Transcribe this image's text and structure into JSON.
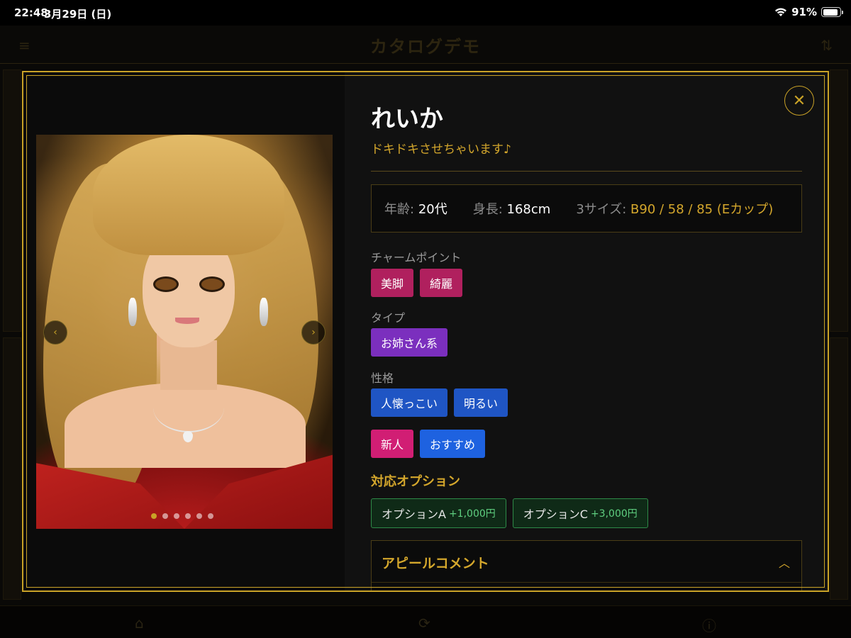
{
  "status_bar": {
    "time": "22:48",
    "date": "3月29日 (日)",
    "battery": "91%",
    "battery_level": 0.91,
    "wifi_icon": "wifi-icon"
  },
  "background": {
    "title": "カタログデモ",
    "menu_icon": "≡",
    "filter_icon": "⇅",
    "tabs": [
      "⌂",
      "⟳",
      "ⓘ"
    ]
  },
  "gallery": {
    "prev_icon": "‹",
    "next_icon": "›",
    "dot_count": 6,
    "active_dot": 0
  },
  "profile": {
    "close_icon": "✕",
    "name": "れいか",
    "catchphrase": "ドキドキさせちゃいます♪",
    "stats": {
      "age_label": "年齢:",
      "age": "20代",
      "height_label": "身長:",
      "height": "168cm",
      "size_label": "3サイズ:",
      "size": "B90 / 58 / 85 (Eカップ)"
    },
    "charm_label": "チャームポイント",
    "charm_tags": [
      "美脚",
      "綺麗"
    ],
    "type_label": "タイプ",
    "type_tags": [
      "お姉さん系"
    ],
    "personality_label": "性格",
    "personality_tags": [
      "人懐っこい",
      "明るい"
    ],
    "badges": [
      "新人",
      "おすすめ"
    ],
    "options_title": "対応オプション",
    "options": [
      {
        "name": "オプションA",
        "price": "+1,000円"
      },
      {
        "name": "オプションC",
        "price": "+3,000円"
      }
    ],
    "appeal_title": "アピールコメント",
    "appeal_chevron": "︿"
  },
  "colors": {
    "gold": "#c9a227",
    "tag_magenta": "#b0205e",
    "tag_purple": "#7b2fbe",
    "tag_blue": "#1f55c4",
    "option_green": "#2e8a48"
  }
}
